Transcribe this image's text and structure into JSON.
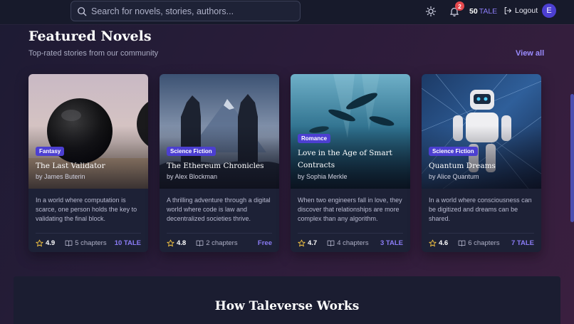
{
  "search": {
    "placeholder": "Search for novels, stories, authors..."
  },
  "header": {
    "notifications_count": "2",
    "balance_amount": "50",
    "balance_unit": "TALE",
    "logout_label": "Logout",
    "avatar_initial": "E"
  },
  "featured": {
    "title": "Featured Novels",
    "subtitle": "Top-rated stories from our community",
    "view_all": "View all",
    "novels": [
      {
        "genre": "Fantasy",
        "title": "The Last Validator",
        "author": "by James Buterin",
        "description": "In a world where computation is scarce, one person holds the key to validating the final block.",
        "rating": "4.9",
        "chapters": "5 chapters",
        "price": "10 TALE"
      },
      {
        "genre": "Science Fiction",
        "title": "The Ethereum Chronicles",
        "author": "by Alex Blockman",
        "description": "A thrilling adventure through a digital world where code is law and decentralized societies thrive.",
        "rating": "4.8",
        "chapters": "2 chapters",
        "price": "Free"
      },
      {
        "genre": "Romance",
        "title": "Love in the Age of Smart Contracts",
        "author": "by Sophia Merkle",
        "description": "When two engineers fall in love, they discover that relationships are more complex than any algorithm.",
        "rating": "4.7",
        "chapters": "4 chapters",
        "price": "3 TALE"
      },
      {
        "genre": "Science Fiction",
        "title": "Quantum Dreams",
        "author": "by Alice Quantum",
        "description": "In a world where consciousness can be digitized and dreams can be shared.",
        "rating": "4.6",
        "chapters": "6 chapters",
        "price": "7 TALE"
      }
    ]
  },
  "how": {
    "title": "How Taleverse Works"
  },
  "colors": {
    "accent": "#8b7cf6",
    "badge": "#e5484d",
    "genre_bg": "#4c3fd1"
  }
}
